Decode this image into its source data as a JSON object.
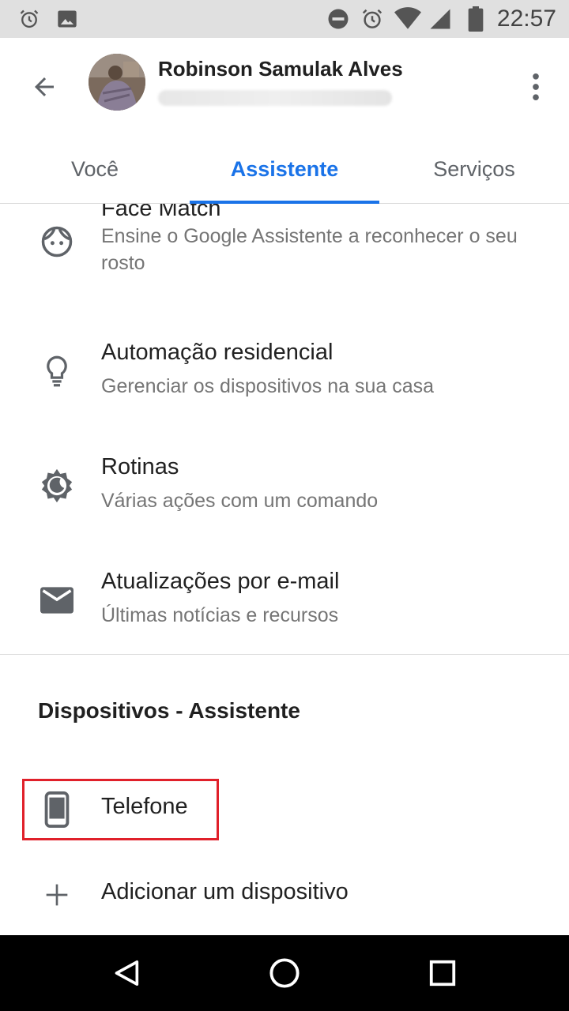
{
  "status_bar": {
    "time": "22:57",
    "left_icons": [
      "alarm-icon",
      "image-icon"
    ],
    "right_icons": [
      "do-not-disturb-icon",
      "alarm-icon",
      "wifi-icon",
      "signal-icon",
      "battery-icon"
    ]
  },
  "header": {
    "account_name": "Robinson Samulak Alves",
    "avatar": "profile-photo",
    "tabs": [
      {
        "label": "Você",
        "active": false
      },
      {
        "label": "Assistente",
        "active": true
      },
      {
        "label": "Serviços",
        "active": false
      }
    ]
  },
  "settings": [
    {
      "icon": "face-icon",
      "title": "Face Match",
      "subtitle": "Ensine o Google Assistente a reconhecer o seu rosto"
    },
    {
      "icon": "lightbulb-icon",
      "title": "Automação residencial",
      "subtitle": "Gerenciar os dispositivos na sua casa"
    },
    {
      "icon": "routines-icon",
      "title": "Rotinas",
      "subtitle": "Várias ações com um comando"
    },
    {
      "icon": "email-icon",
      "title": "Atualizações por e-mail",
      "subtitle": "Últimas notícias e recursos"
    }
  ],
  "devices_section": {
    "title": "Dispositivos - Assistente",
    "items": [
      {
        "icon": "phone-icon",
        "label": "Telefone",
        "highlighted": true
      },
      {
        "icon": "add-icon",
        "label": "Adicionar um dispositivo"
      }
    ]
  },
  "colors": {
    "accent": "#1a73e8",
    "highlight": "#e0202a",
    "status_bar": "#e0e0e0",
    "nav_bar": "#000000"
  }
}
